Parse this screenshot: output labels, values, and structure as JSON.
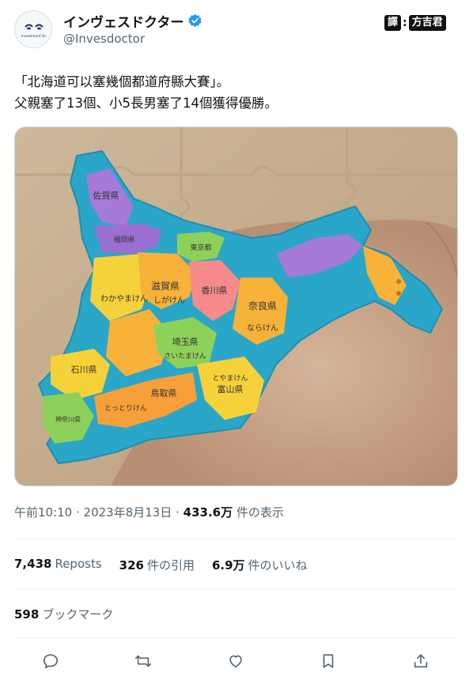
{
  "author": {
    "display_name": "インヴェスドクター",
    "handle": "@Invesdoctor",
    "avatar_text": "Investment Dr."
  },
  "watermark": {
    "part1": "譯",
    "part2": "方吉君"
  },
  "tweet": {
    "line1": "「北海道可以塞幾個都道府縣大賽」。",
    "line2": "父親塞了13個、小5長男塞了14個獲得優勝。"
  },
  "puzzle_labels": {
    "saga": "佐賀県",
    "fukuoka": "福岡県",
    "tokyo": "東京都",
    "shiga": "滋賀県",
    "shiga_kana": "しがけん",
    "kagawa": "香川県",
    "nara": "奈良県",
    "nara_kana": "ならけん",
    "wakayama_kana": "わかやまけん",
    "saitama": "埼玉県",
    "saitama_kana": "さいたまけん",
    "ishikawa": "石川県",
    "kanagawa": "神奈川県",
    "tottori": "鳥取県",
    "tottori_kana": "とっとりけん",
    "toyama": "富山県",
    "toyama_kana": "とやまけん"
  },
  "meta": {
    "time": "午前10:10",
    "sep1": " · ",
    "date": "2023年8月13日",
    "sep2": " · ",
    "views": "433.6万",
    "views_label": " 件の表示"
  },
  "stats": {
    "reposts_count": "7,438",
    "reposts_label": "Reposts",
    "quotes_count": "326",
    "quotes_label": "件の引用",
    "likes_count": "6.9万",
    "likes_label": "件のいいね"
  },
  "bookmarks": {
    "count": "598",
    "label": "ブックマーク"
  },
  "colors": {
    "accent": "#1d9bf0",
    "muted": "#536471",
    "puzzle_blue": "#2aa6c8"
  }
}
